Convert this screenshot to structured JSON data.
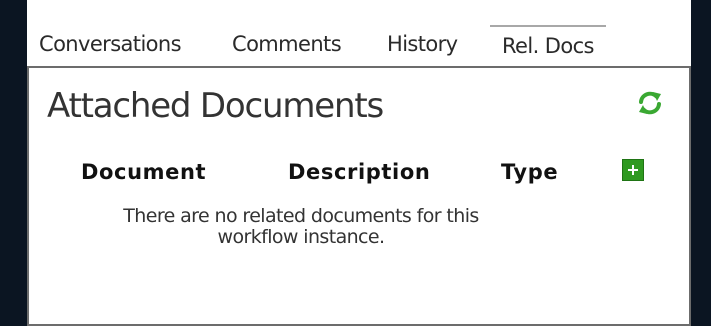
{
  "tabs": [
    {
      "label": "Conversations"
    },
    {
      "label": "Comments"
    },
    {
      "label": "History"
    },
    {
      "label": "Rel. Docs"
    }
  ],
  "active_tab": "Rel. Docs",
  "panel": {
    "title": "Attached Documents",
    "refresh_icon": "refresh-icon",
    "add_icon": "plus-icon",
    "columns": [
      "Document",
      "Description",
      "Type"
    ],
    "empty_message": "There are no related documents for this workflow instance."
  },
  "colors": {
    "frame_background": "#0b1522",
    "refresh_green": "#3aa832",
    "add_button_green": "#2f9a20",
    "border": "#6c6c6c"
  }
}
